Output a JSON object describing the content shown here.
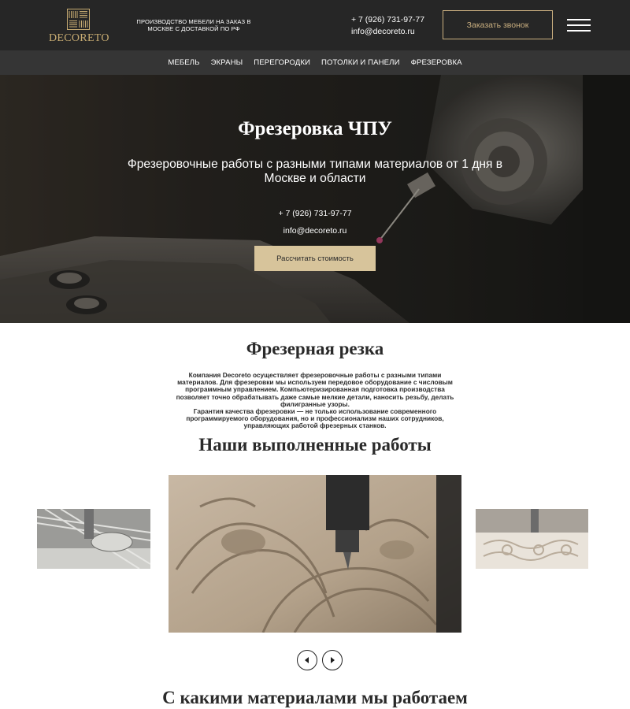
{
  "header": {
    "logo_text": "DECORETO",
    "tagline": "ПРОИЗВОДСТВО МЕБЕЛИ НА ЗАКАЗ В МОСКВЕ С ДОСТАВКОЙ ПО РФ",
    "phone": "+ 7 (926) 731-97-77",
    "email": "info@decoreto.ru",
    "callback_label": "Заказать звонок"
  },
  "nav": {
    "items": [
      "МЕБЕЛЬ",
      "ЭКРАНЫ",
      "ПЕРЕГОРОДКИ",
      "ПОТОЛКИ И ПАНЕЛИ",
      "ФРЕЗЕРОВКА"
    ]
  },
  "hero": {
    "title": "Фрезеровка ЧПУ",
    "subtitle": "Фрезеровочные работы с разными типами материалов от 1 дня в Москве и области",
    "phone": "+ 7 (926) 731-97-77",
    "email": "info@decoreto.ru",
    "cta_label": "Рассчитать стоимость"
  },
  "about": {
    "title": "Фрезерная резка",
    "paragraph1": "Компания Decoreto осуществляет фрезеровочные работы с разными типами материалов. Для фрезеровки мы используем передовое оборудование с числовым программным управлением. Компьютеризированная подготовка производства позволяет точно обрабатывать даже самые мелкие детали, наносить резьбу, делать филигранные узоры.",
    "paragraph2": "Гарантия качества фрезеровки — не только использование современного программируемого оборудования, но и профессионализм наших сотрудников, управляющих работой фрезерных станков."
  },
  "works": {
    "title": "Наши выполненные работы"
  },
  "materials": {
    "title": "С какими материалами мы работаем"
  },
  "colors": {
    "header_bg": "#262626",
    "nav_bg": "#353535",
    "gold": "#c8ac72",
    "button_bg": "#d7c49b"
  }
}
